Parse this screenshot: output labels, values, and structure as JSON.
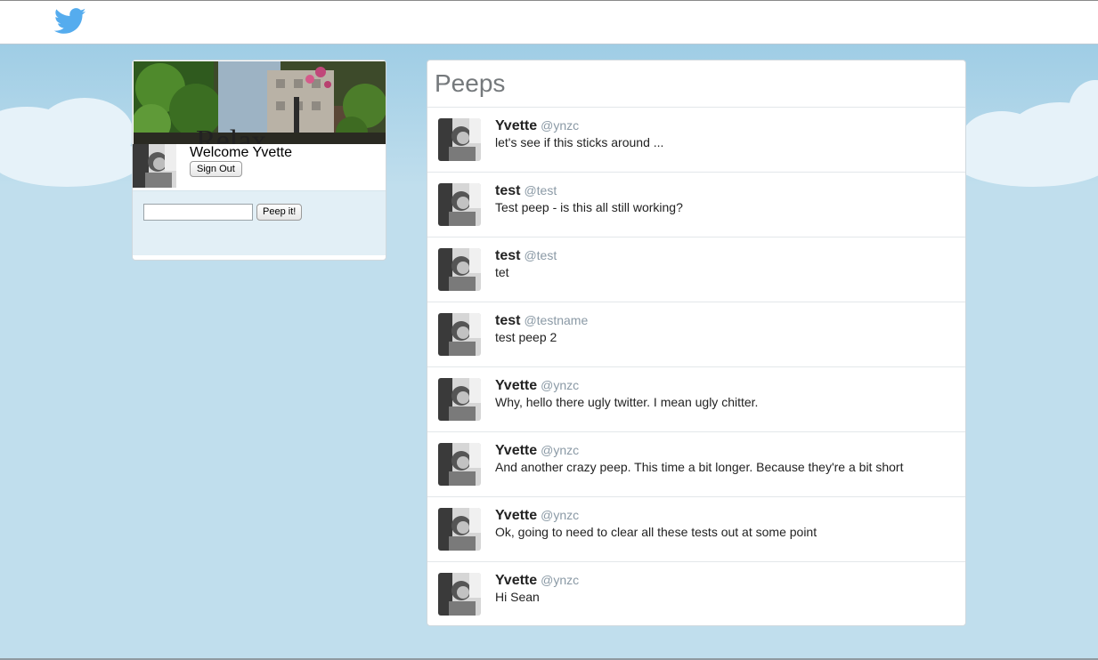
{
  "header": {
    "logo_icon": "twitter-bird-icon",
    "brand_color": "#55acee"
  },
  "profile": {
    "welcome_text": "Welcome Yvette",
    "sign_out_label": "Sign Out",
    "peep_button_label": "Peep it!",
    "peep_input_value": "",
    "peep_input_placeholder": ""
  },
  "feed": {
    "title": "Peeps",
    "peeps": [
      {
        "name": "Yvette",
        "handle": "@ynzc",
        "text": "let's see if this sticks around ..."
      },
      {
        "name": "test",
        "handle": "@test",
        "text": "Test peep - is this all still working?"
      },
      {
        "name": "test",
        "handle": "@test",
        "text": "tet"
      },
      {
        "name": "test",
        "handle": "@testname",
        "text": "test peep 2"
      },
      {
        "name": "Yvette",
        "handle": "@ynzc",
        "text": "Why, hello there ugly twitter. I mean ugly chitter."
      },
      {
        "name": "Yvette",
        "handle": "@ynzc",
        "text": "And another crazy peep. This time a bit longer. Because they're a bit short"
      },
      {
        "name": "Yvette",
        "handle": "@ynzc",
        "text": "Ok, going to need to clear all these tests out at some point"
      },
      {
        "name": "Yvette",
        "handle": "@ynzc",
        "text": "Hi Sean"
      }
    ]
  },
  "colors": {
    "background": "#c0deed",
    "handle": "#8a99a5",
    "title": "#75797c"
  }
}
